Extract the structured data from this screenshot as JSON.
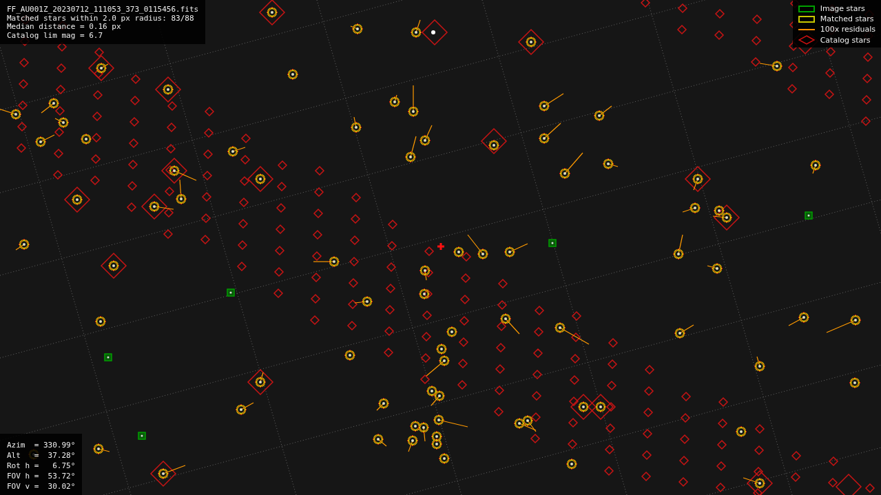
{
  "info_box": {
    "lines": [
      "FF_AU001Z_20230712_111053_373_0115456.fits",
      "Matched stars within 2.0 px radius: 83/88",
      "Median distance = 0.16 px",
      "Catalog lim mag = 6.7"
    ]
  },
  "legend": [
    {
      "kind": "box",
      "color": "#00a000",
      "label": "Image stars"
    },
    {
      "kind": "box",
      "color": "#c8c800",
      "label": "Matched stars"
    },
    {
      "kind": "line",
      "color": "#ff8c00",
      "label": "100x residuals"
    },
    {
      "kind": "diamond",
      "color": "#d01010",
      "label": "Catalog stars"
    }
  ],
  "pointing": {
    "lines": [
      "Azim  = 330.99°",
      "Alt   =  37.28°",
      "Rot h =   6.75°",
      "FOV h =  53.72°",
      "FOV v =  30.02°"
    ]
  }
}
